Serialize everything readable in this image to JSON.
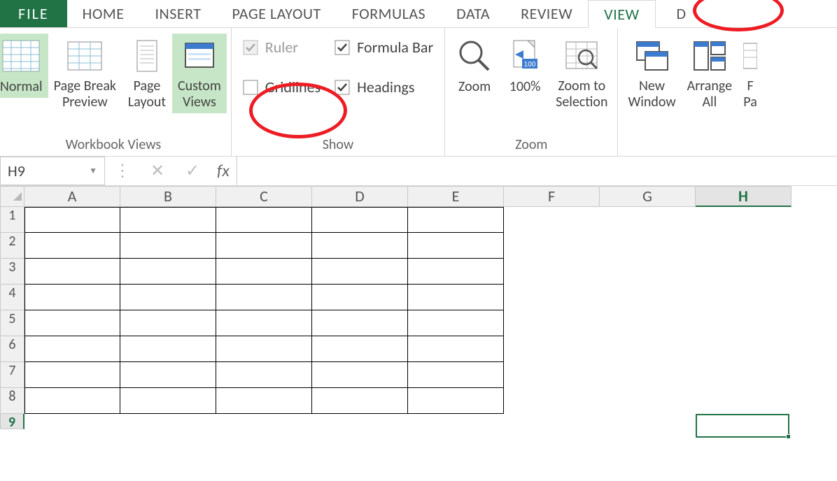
{
  "tabs": {
    "file": "FILE",
    "home": "HOME",
    "insert": "INSERT",
    "page_layout": "PAGE LAYOUT",
    "formulas": "FORMULAS",
    "data": "DATA",
    "review": "REVIEW",
    "view": "VIEW",
    "developer_cut": "D"
  },
  "ribbon": {
    "workbook_views": {
      "label": "Workbook Views",
      "normal": "Normal",
      "page_break": "Page Break",
      "preview": "Preview",
      "page": "Page",
      "layout": "Layout",
      "custom": "Custom",
      "views": "Views"
    },
    "show": {
      "label": "Show",
      "ruler": "Ruler",
      "gridlines": "Gridlines",
      "formula_bar": "Formula Bar",
      "headings": "Headings"
    },
    "zoom": {
      "label": "Zoom",
      "zoom": "Zoom",
      "hundred": "100%",
      "zoom_to": "Zoom to",
      "selection": "Selection"
    },
    "window": {
      "new": "New",
      "window": "Window",
      "arrange": "Arrange",
      "all": "All",
      "freeze_cut": "F",
      "panes_cut": "Pa"
    }
  },
  "formula_bar": {
    "name_box": "H9",
    "fx": "fx",
    "formula": ""
  },
  "grid": {
    "columns": [
      "A",
      "B",
      "C",
      "D",
      "E",
      "F",
      "G",
      "H"
    ],
    "active_column": "H",
    "rows": [
      "1",
      "2",
      "3",
      "4",
      "5",
      "6",
      "7",
      "8",
      "9"
    ],
    "active_row": "9",
    "bordered_cols": 5,
    "bordered_rows": 8
  }
}
